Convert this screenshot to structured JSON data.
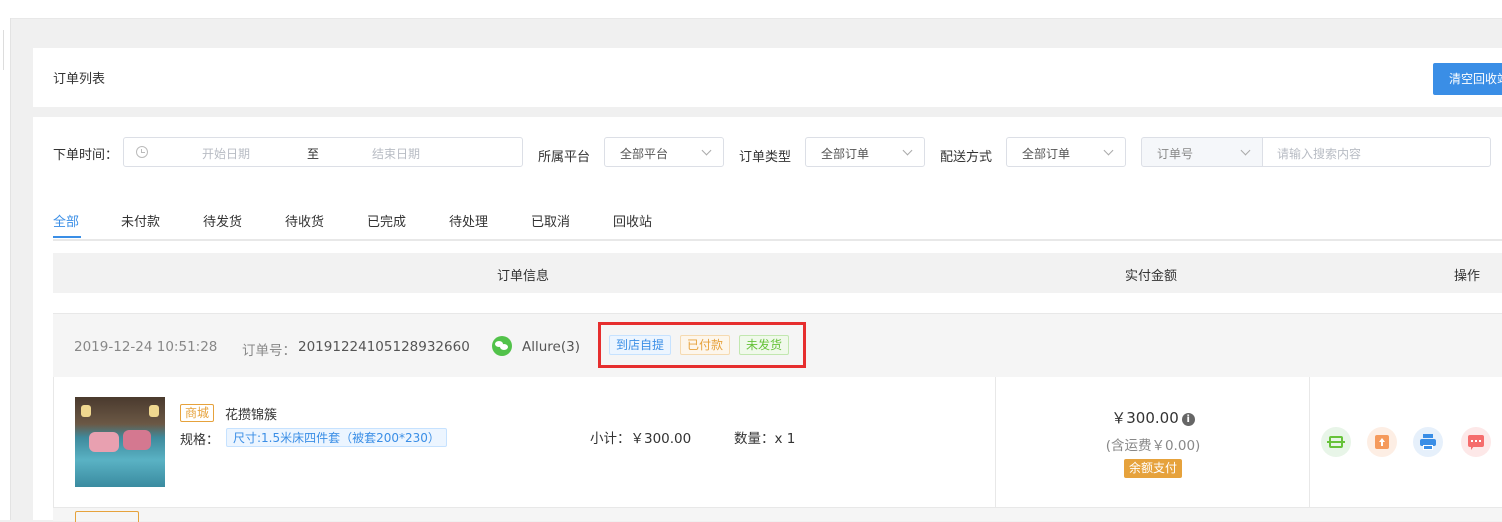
{
  "header": {
    "title": "订单列表",
    "clear_button": "清空回收站"
  },
  "filters": {
    "order_time_label": "下单时间：",
    "start_placeholder": "开始日期",
    "range_separator": "至",
    "end_placeholder": "结束日期",
    "platform_label": "所属平台",
    "platform_value": "全部平台",
    "order_type_label": "订单类型",
    "order_type_value": "全部订单",
    "delivery_label": "配送方式",
    "delivery_value": "全部订单",
    "search_field_value": "订单号",
    "search_placeholder": "请输入搜索内容"
  },
  "tabs": [
    "全部",
    "未付款",
    "待发货",
    "待收货",
    "已完成",
    "待处理",
    "已取消",
    "回收站"
  ],
  "active_tab": "全部",
  "table": {
    "col_order_info": "订单信息",
    "col_paid_amount": "实付金额",
    "col_actions": "操作"
  },
  "order": {
    "datetime": "2019-12-24 10:51:28",
    "order_no_label": "订单号：",
    "order_no": "20191224105128932660",
    "buyer": "Allure(3)",
    "status_tags": [
      {
        "text": "到店自提",
        "color": "#3a8ee6"
      },
      {
        "text": "已付款",
        "color": "#e6a23c"
      },
      {
        "text": "未发货",
        "color": "#67c23a"
      }
    ],
    "item": {
      "source_tag": "商城",
      "name": "花攒锦簇",
      "spec_label": "规格：",
      "spec": "尺寸:1.5米床四件套（被套200*230）",
      "subtotal": "小计：￥300.00",
      "quantity": "数量：x 1"
    },
    "amount": "￥300.00",
    "shipping_fee": "(含运费￥0.00)",
    "pay_method": "余额支付",
    "actions": [
      "scan-icon",
      "upload-icon",
      "print-icon",
      "message-icon"
    ]
  },
  "colors": {
    "primary": "#3a8ee6",
    "warning": "#e6a23c",
    "success": "#67c23a",
    "danger": "#e62e2e"
  }
}
